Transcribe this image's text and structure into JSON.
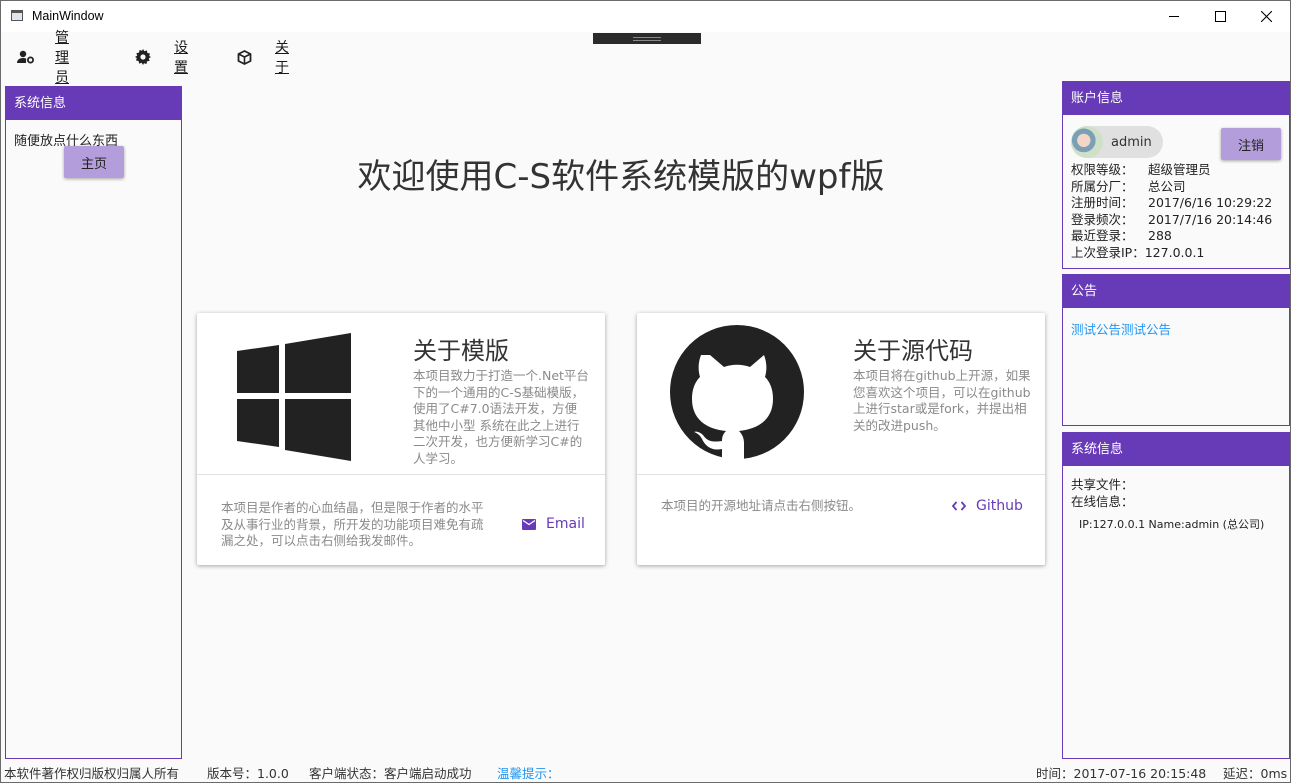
{
  "window": {
    "title": "MainWindow"
  },
  "menu": [
    {
      "label": "管理员",
      "icon": "user-settings-icon"
    },
    {
      "label": "设置",
      "icon": "gear-icon"
    },
    {
      "label": "关于",
      "icon": "cube-icon"
    }
  ],
  "left_panel": {
    "title": "系统信息",
    "text": "随便放点什么东西",
    "home_button": "主页"
  },
  "main": {
    "welcome": "欢迎使用C-S软件系统模版的wpf版",
    "card_template": {
      "title": "关于模版",
      "desc": "本项目致力于打造一个.Net平台下的一个通用的C-S基础模版，使用了C#7.0语法开发，方便其他中小型 系统在此之上进行二次开发，也方便新学习C#的人学习。",
      "footer": "本项目是作者的心血结晶，但是限于作者的水平及从事行业的背景，所开发的功能项目难免有疏漏之处，可以点击右侧给我发邮件。",
      "action": "Email",
      "icon": "windows-logo-icon"
    },
    "card_source": {
      "title": "关于源代码",
      "desc": "本项目将在github上开源，如果您喜欢这个项目，可以在github上进行star或是fork，并提出相关的改进push。",
      "footer": "本项目的开源地址请点击右侧按钮。",
      "action": "Github",
      "icon": "github-logo-icon"
    }
  },
  "account": {
    "title": "账户信息",
    "username": "admin",
    "logout_button": "注销",
    "rows": [
      {
        "label": "权限等级：",
        "value": "超级管理员"
      },
      {
        "label": "所属分厂：",
        "value": "总公司"
      },
      {
        "label": "注册时间：",
        "value": "2017/6/16 10:29:22"
      },
      {
        "label": "登录频次：",
        "value": "2017/7/16 20:14:46"
      },
      {
        "label": "最近登录：",
        "value": "288"
      },
      {
        "label": "上次登录IP：",
        "value": "127.0.0.1"
      }
    ]
  },
  "notice": {
    "title": "公告",
    "link": "测试公告测试公告"
  },
  "sys_info": {
    "title": "系统信息",
    "shared_files_label": "共享文件：",
    "online_label": "在线信息：",
    "online_entry": "IP:127.0.0.1 Name:admin (总公司)"
  },
  "status": {
    "copyright": "本软件著作权归版权归属人所有",
    "version": "版本号：1.0.0",
    "client_state": "客户端状态：客户端启动成功",
    "tip": "温馨提示：",
    "time": "时间：2017-07-16 20:15:48",
    "delay": "延迟：0ms"
  },
  "colors": {
    "accent": "#673ab7",
    "button": "#b39ddb",
    "link": "#2196f3"
  }
}
